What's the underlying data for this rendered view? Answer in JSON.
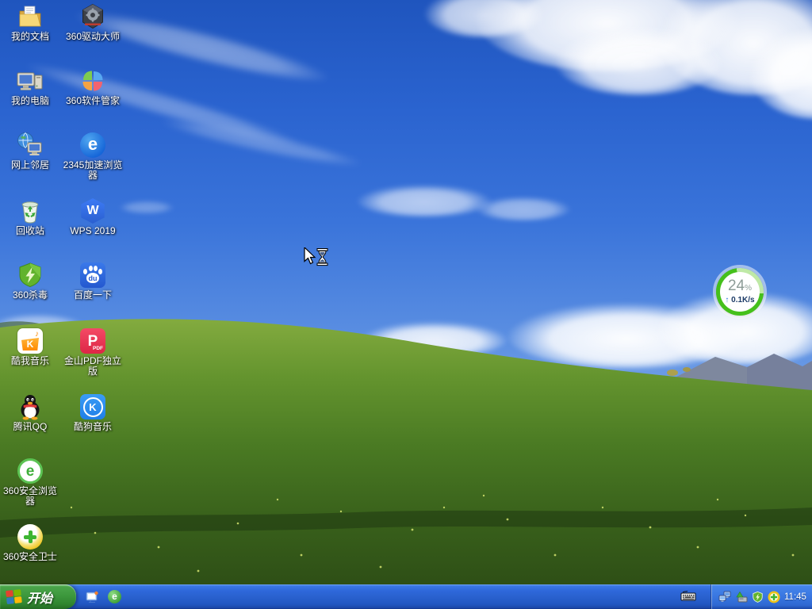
{
  "desktop": {
    "icons": [
      {
        "label": "我的文档"
      },
      {
        "label": "我的电脑"
      },
      {
        "label": "网上邻居"
      },
      {
        "label": "回收站"
      },
      {
        "label": "360杀毒"
      },
      {
        "label": "酷我音乐",
        "glyph": "K",
        "note": "♪"
      },
      {
        "label": "腾讯QQ"
      },
      {
        "label": "360安全浏览器",
        "glyph": "e"
      },
      {
        "label": "360安全卫士"
      },
      {
        "label": "360驱动大师"
      },
      {
        "label": "360软件管家"
      },
      {
        "label": "2345加速浏览器",
        "glyph": "e"
      },
      {
        "label": "WPS 2019",
        "glyph": "W"
      },
      {
        "label": "百度一下",
        "glyph": "du"
      },
      {
        "label": "金山PDF独立版",
        "glyph": "P",
        "sub": "PDF"
      },
      {
        "label": "酷狗音乐",
        "glyph": "K"
      }
    ]
  },
  "widget": {
    "percent": "24",
    "unit": "%",
    "arrow": "↑",
    "speed": "0.1K/s"
  },
  "taskbar": {
    "start_label": "开始",
    "clock": "11:45",
    "quicklaunch_browser_glyph": "e"
  },
  "colors": {
    "taskbar_blue": "#2A62D8",
    "start_green": "#3D983D",
    "ring_green": "#45C01B",
    "speed_text": "#1B3A66",
    "sky_blue": "#2A63CF",
    "hill_green": "#5C8A2B"
  }
}
